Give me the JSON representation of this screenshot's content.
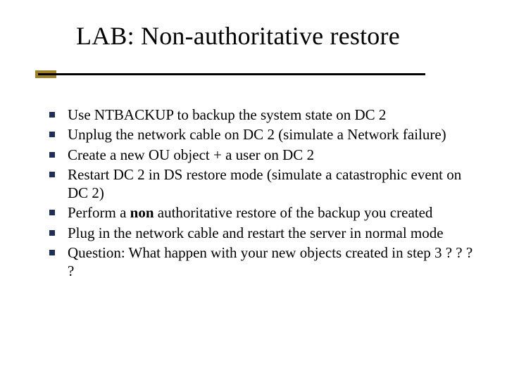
{
  "title": "LAB: Non-authoritative restore",
  "bullets": [
    {
      "pre": "Use NTBACKUP to backup the system state on DC 2",
      "bold": "",
      "post": ""
    },
    {
      "pre": "Unplug the network cable on DC 2 (simulate a Network failure)",
      "bold": "",
      "post": ""
    },
    {
      "pre": "Create a new OU object + a user on DC 2",
      "bold": "",
      "post": ""
    },
    {
      "pre": "Restart DC 2 in DS restore mode (simulate a catastrophic event on DC 2)",
      "bold": "",
      "post": ""
    },
    {
      "pre": "Perform a ",
      "bold": "non",
      "post": " authoritative restore of the backup you created"
    },
    {
      "pre": "Plug in the network cable and restart the server in normal mode",
      "bold": "",
      "post": ""
    },
    {
      "pre": "Question: What happen with your new objects created in step 3 ? ? ? ?",
      "bold": "",
      "post": ""
    }
  ]
}
